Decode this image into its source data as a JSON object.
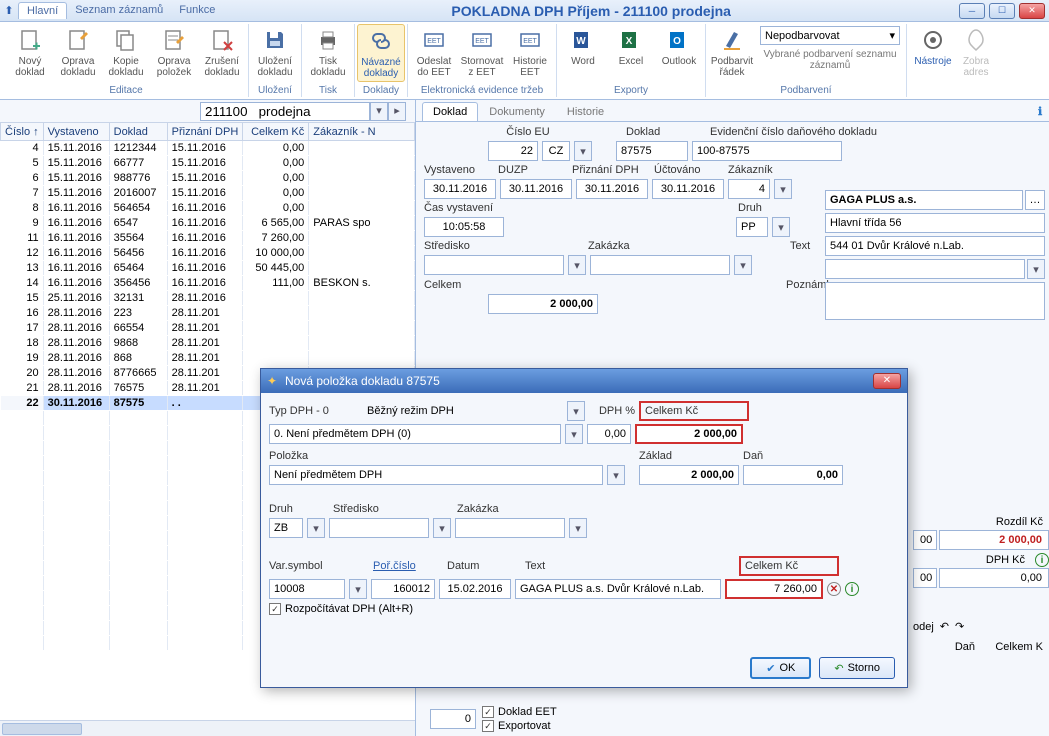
{
  "title": "POKLADNA DPH Příjem - 211100   prodejna",
  "menu": [
    "Hlavní",
    "Seznam záznamů",
    "Funkce"
  ],
  "ribbon": [
    {
      "label": "Editace",
      "items": [
        "Nový doklad",
        "Oprava dokladu",
        "Kopie dokladu",
        "Oprava položek",
        "Zrušení dokladu"
      ]
    },
    {
      "label": "Uložení",
      "items": [
        "Uložení dokladu"
      ]
    },
    {
      "label": "Tisk",
      "items": [
        "Tisk dokladu"
      ]
    },
    {
      "label": "Doklady",
      "items": [
        "Návazné doklady"
      ]
    },
    {
      "label": "Elektronická evidence tržeb",
      "items": [
        "Odeslat do EET",
        "Stornovat z EET",
        "Historie EET"
      ]
    },
    {
      "label": "Exporty",
      "items": [
        "Word",
        "Excel",
        "Outlook"
      ]
    },
    {
      "label": "Podbarvení",
      "items": [
        "Podbarvit řádek"
      ],
      "extra": {
        "combo": "Nepodbarvovat",
        "sub": "Vybrané podbarvení seznamu záznamů"
      }
    },
    {
      "label": "",
      "items": [
        "Nástroje",
        "Zobra adres"
      ]
    }
  ],
  "left_header": "211100   prodejna",
  "grid_cols": [
    "Číslo ↑",
    "Vystaveno",
    "Doklad",
    "Přiznání DPH",
    "Celkem Kč",
    "Zákazník - N"
  ],
  "rows": [
    {
      "c": "4",
      "v": "15.11.2016",
      "d": "1212344",
      "p": "15.11.2016",
      "k": "0,00",
      "z": ""
    },
    {
      "c": "5",
      "v": "15.11.2016",
      "d": "66777",
      "p": "15.11.2016",
      "k": "0,00",
      "z": ""
    },
    {
      "c": "6",
      "v": "15.11.2016",
      "d": "988776",
      "p": "15.11.2016",
      "k": "0,00",
      "z": ""
    },
    {
      "c": "7",
      "v": "15.11.2016",
      "d": "2016007",
      "p": "15.11.2016",
      "k": "0,00",
      "z": ""
    },
    {
      "c": "8",
      "v": "16.11.2016",
      "d": "564654",
      "p": "16.11.2016",
      "k": "0,00",
      "z": ""
    },
    {
      "c": "9",
      "v": "16.11.2016",
      "d": "6547",
      "p": "16.11.2016",
      "k": "6 565,00",
      "z": "PARAS spo"
    },
    {
      "c": "11",
      "v": "16.11.2016",
      "d": "35564",
      "p": "16.11.2016",
      "k": "7 260,00",
      "z": ""
    },
    {
      "c": "12",
      "v": "16.11.2016",
      "d": "56456",
      "p": "16.11.2016",
      "k": "10 000,00",
      "z": ""
    },
    {
      "c": "13",
      "v": "16.11.2016",
      "d": "65464",
      "p": "16.11.2016",
      "k": "50 445,00",
      "z": ""
    },
    {
      "c": "14",
      "v": "16.11.2016",
      "d": "356456",
      "p": "16.11.2016",
      "k": "111,00",
      "z": "BESKON s."
    },
    {
      "c": "15",
      "v": "25.11.2016",
      "d": "32131",
      "p": "28.11.2016",
      "k": "",
      "z": ""
    },
    {
      "c": "16",
      "v": "28.11.2016",
      "d": "223",
      "p": "28.11.201",
      "k": "",
      "z": ""
    },
    {
      "c": "17",
      "v": "28.11.2016",
      "d": "66554",
      "p": "28.11.201",
      "k": "",
      "z": ""
    },
    {
      "c": "18",
      "v": "28.11.2016",
      "d": "9868",
      "p": "28.11.201",
      "k": "",
      "z": ""
    },
    {
      "c": "19",
      "v": "28.11.2016",
      "d": "868",
      "p": "28.11.201",
      "k": "",
      "z": ""
    },
    {
      "c": "20",
      "v": "28.11.2016",
      "d": "8776665",
      "p": "28.11.201",
      "k": "",
      "z": ""
    },
    {
      "c": "21",
      "v": "28.11.2016",
      "d": "76575",
      "p": "28.11.201",
      "k": "",
      "z": ""
    },
    {
      "c": "22",
      "v": "30.11.2016",
      "d": "87575",
      "p": ".  .",
      "k": "",
      "z": "",
      "sel": true
    }
  ],
  "tabs": [
    "Doklad",
    "Dokumenty",
    "Historie"
  ],
  "form": {
    "cislo_eu_lbl": "Číslo EU",
    "cislo_eu": "22",
    "cz": "CZ",
    "doklad_lbl": "Doklad",
    "doklad": "87575",
    "evid_lbl": "Evidenční číslo daňového dokladu",
    "evid": "100-87575",
    "vystaveno_lbl": "Vystaveno",
    "vystaveno": "30.11.2016",
    "duzp_lbl": "DUZP",
    "duzp": "30.11.2016",
    "priznani_lbl": "Přiznání DPH",
    "priznani": "30.11.2016",
    "uctovano_lbl": "Účtováno",
    "uctovano": "30.11.2016",
    "zakaznik_lbl": "Zákazník",
    "zakaznik": "4",
    "cas_lbl": "Čas vystavení",
    "cas": "10:05:58",
    "druh_lbl": "Druh",
    "druh": "PP",
    "stredisko_lbl": "Středisko",
    "zakazka_lbl": "Zakázka",
    "text_lbl": "Text",
    "celkem_lbl": "Celkem",
    "celkem": "2 000,00",
    "poznamka_lbl": "Poznámka",
    "cust_name": "GAGA PLUS a.s.",
    "cust_addr1": "Hlavní třída 56",
    "cust_addr2": "544 01 Dvůr Králové n.Lab."
  },
  "side": {
    "rozdil_lbl": "Rozdíl Kč",
    "rozdil": "2 000,00",
    "dph_lbl": "DPH Kč",
    "dph": "0,00",
    "val00": "00",
    "prodej": "odej",
    "dan_lbl": "Daň",
    "celkemk_lbl": "Celkem K"
  },
  "dialog": {
    "title": "Nová položka dokladu 87575",
    "typ_lbl": "Typ DPH - 0",
    "rezim": "Běžný režim DPH",
    "dph_pct_lbl": "DPH %",
    "dph_pct": "0,00",
    "celkem_lbl": "Celkem Kč",
    "celkem": "2 000,00",
    "combo": "0.  Není předmětem DPH  (0)",
    "polozka_lbl": "Položka",
    "polozka": "Není předmětem DPH",
    "zaklad_lbl": "Základ",
    "zaklad": "2 000,00",
    "dan_lbl": "Daň",
    "dan": "0,00",
    "druh_lbl": "Druh",
    "druh": "ZB",
    "stredisko_lbl": "Středisko",
    "zakazka_lbl": "Zakázka",
    "var_lbl": "Var.symbol",
    "var": "10008",
    "por_lbl": "Poř.číslo",
    "por": "160012",
    "datum_lbl": "Datum",
    "datum": "15.02.2016",
    "text_lbl": "Text",
    "text": "GAGA PLUS a.s.  Dvůr Králové n.Lab.",
    "celkem2_lbl": "Celkem Kč",
    "celkem2": "7 260,00",
    "chk": "Rozpočítávat DPH (Alt+R)",
    "ok": "OK",
    "storno": "Storno"
  },
  "footer": {
    "zero": "0",
    "eet": "Doklad EET",
    "exp": "Exportovat"
  }
}
